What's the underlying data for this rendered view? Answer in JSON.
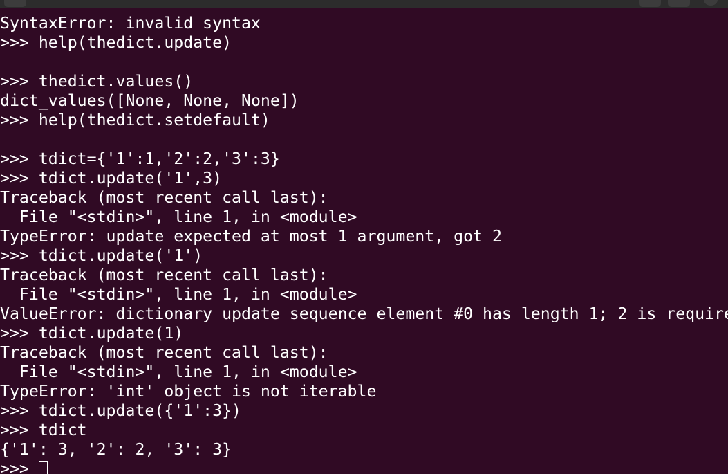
{
  "window": {
    "title": ""
  },
  "terminal": {
    "lines": [
      "SyntaxError: invalid syntax",
      ">>> help(thedict.update)",
      "",
      ">>> thedict.values()",
      "dict_values([None, None, None])",
      ">>> help(thedict.setdefault)",
      "",
      ">>> tdict={'1':1,'2':2,'3':3}",
      ">>> tdict.update('1',3)",
      "Traceback (most recent call last):",
      "  File \"<stdin>\", line 1, in <module>",
      "TypeError: update expected at most 1 argument, got 2",
      ">>> tdict.update('1')",
      "Traceback (most recent call last):",
      "  File \"<stdin>\", line 1, in <module>",
      "ValueError: dictionary update sequence element #0 has length 1; 2 is require",
      ">>> tdict.update(1)",
      "Traceback (most recent call last):",
      "  File \"<stdin>\", line 1, in <module>",
      "TypeError: 'int' object is not iterable",
      ">>> tdict.update({'1':3})",
      ">>> tdict",
      "{'1': 3, '2': 2, '3': 3}"
    ],
    "prompt": ">>> "
  },
  "colors": {
    "background": "#300a24",
    "foreground": "#ffffff",
    "titlebar": "#2c2c2c"
  }
}
